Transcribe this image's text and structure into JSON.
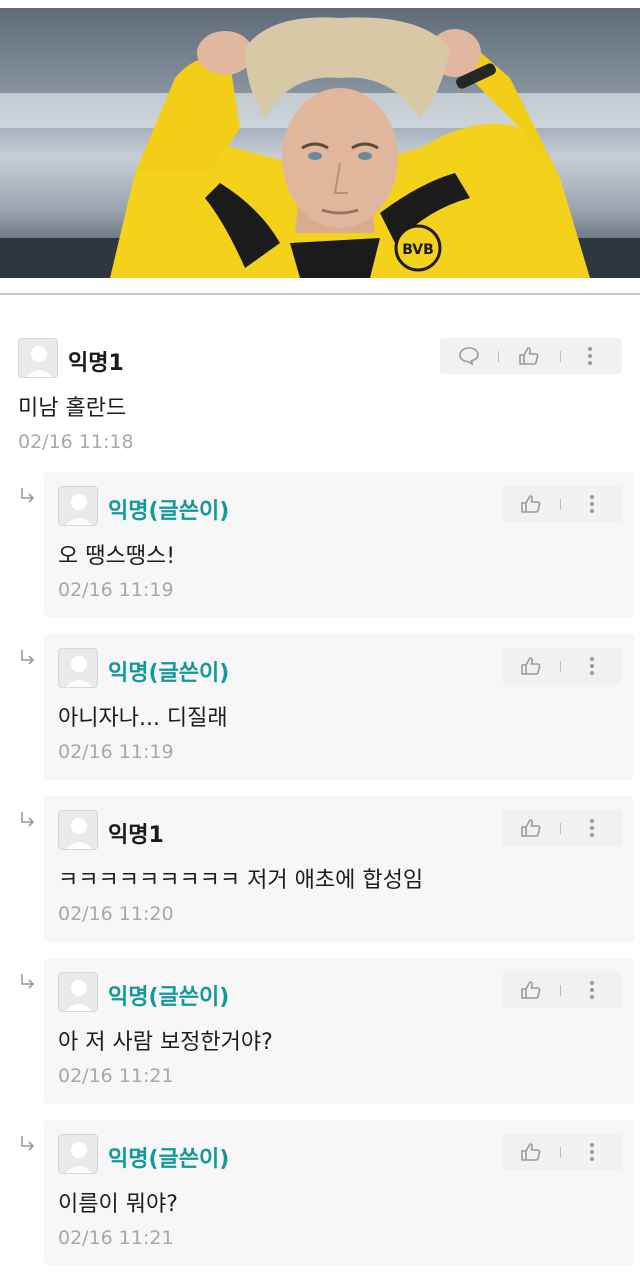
{
  "post_image": {
    "alt": "photo-of-footballer",
    "colors": {
      "jersey": "#f4d21b",
      "hair": "#d7c9a6",
      "skin": "#e0b79d",
      "background": "#8c98a4"
    }
  },
  "comments": [
    {
      "author": "익명1",
      "text": "미남 홀란드",
      "time": "02/16 11:18"
    },
    {
      "author": "익명(글쓴이)",
      "text": "오 땡스땡스!",
      "time": "02/16 11:19"
    },
    {
      "author": "익명(글쓴이)",
      "text": "아니자나... 디질래",
      "time": "02/16 11:19"
    },
    {
      "author": "익명1",
      "text": "ㅋㅋㅋㅋㅋㅋㅋㅋㅋ 저거 애초에 합성임",
      "time": "02/16 11:20"
    },
    {
      "author": "익명(글쓴이)",
      "text": "아 저 사람 보정한거야?",
      "time": "02/16 11:21"
    },
    {
      "author": "익명(글쓴이)",
      "text": "이름이 뭐야?",
      "time": "02/16 11:21"
    }
  ],
  "colors": {
    "writer_name": "#149999",
    "timestamp": "#a8a8a8",
    "reply_bg": "#f7f7f8"
  },
  "icons": {
    "reply": "speech-bubble-icon",
    "like": "thumbs-up-icon",
    "more": "vertical-dots-icon"
  }
}
